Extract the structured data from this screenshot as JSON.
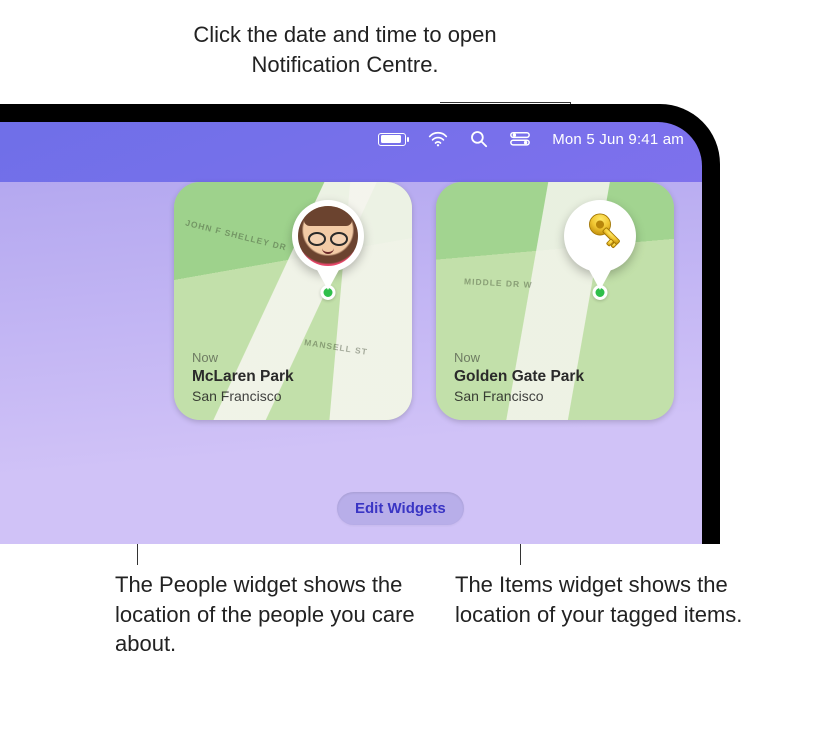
{
  "callouts": {
    "top": "Click the date and time to open Notification Centre.",
    "bottom_left": "The People widget shows the location of the people you care about.",
    "bottom_right": "The Items widget shows the location of your tagged items."
  },
  "menubar": {
    "datetime": "Mon 5 Jun  9:41 am"
  },
  "widgets": {
    "people": {
      "timestamp": "Now",
      "place": "McLaren Park",
      "city": "San Francisco",
      "roads": [
        "JOHN F SHELLEY DR",
        "MANSELL ST"
      ]
    },
    "items": {
      "timestamp": "Now",
      "place": "Golden Gate Park",
      "city": "San Francisco",
      "roads": [
        "MIDDLE DR W"
      ]
    }
  },
  "controls": {
    "edit_widgets": "Edit Widgets"
  }
}
